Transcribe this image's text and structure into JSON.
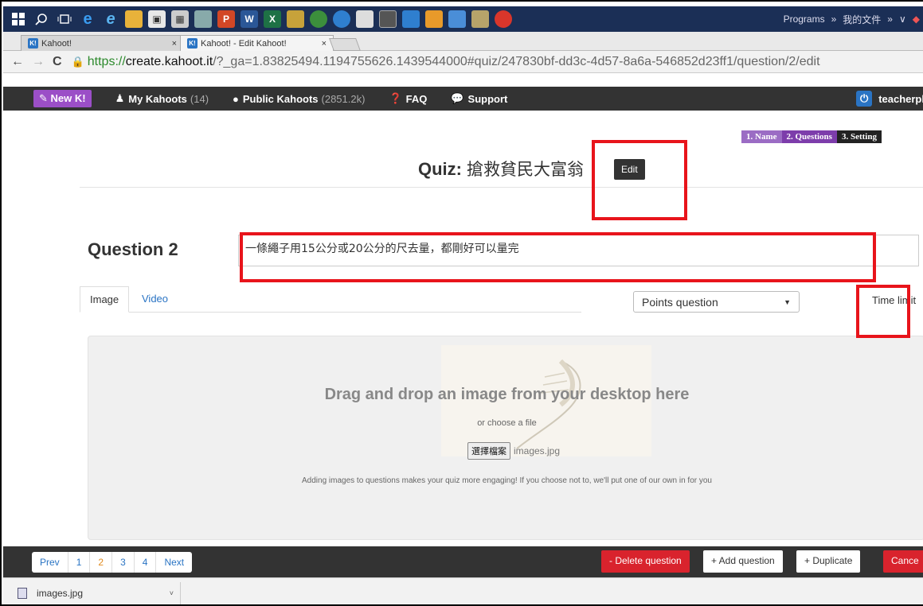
{
  "taskbar": {
    "programs_label": "Programs",
    "docs_label": "我的文件",
    "more_glyph": "»"
  },
  "browser": {
    "tab1_title": "Kahoot!",
    "tab2_title": "Kahoot! - Edit Kahoot!",
    "url_scheme": "https://",
    "url_host": "create.kahoot.it",
    "url_path": "/?_ga=1.83825494.1194755626.1439544000#quiz/247830bf-dd3c-4d57-8a6a-546852d23ff1/question/2/edit"
  },
  "nav": {
    "new_k": "New K!",
    "my_kahoots": "My Kahoots",
    "my_kahoots_count": "(14)",
    "public_kahoots": "Public Kahoots",
    "public_count": "(2851.2k)",
    "faq": "FAQ",
    "support": "Support",
    "user": "teacherpl"
  },
  "steps": [
    "1. Name",
    "2. Questions",
    "3. Setting"
  ],
  "quiz": {
    "label": "Quiz:",
    "name": "搶救貧民大富翁",
    "edit_label": "Edit"
  },
  "question": {
    "label": "Question 2",
    "text": "一條繩子用15公分或20公分的尺去量，都剛好可以量完"
  },
  "media_tabs": [
    "Image",
    "Video"
  ],
  "points_select": "Points question",
  "time_limit_label": "Time limit",
  "dropzone": {
    "main": "Drag and drop an image from your desktop here",
    "or": "or choose a file",
    "choose_btn": "選擇檔案",
    "file_name": "images.jpg",
    "hint": "Adding images to questions makes your quiz more engaging! If you choose not to, we'll put one of our own in for you"
  },
  "pager": [
    "Prev",
    "1",
    "2",
    "3",
    "4",
    "Next"
  ],
  "footer_buttons": {
    "delete": "- Delete question",
    "add": "+ Add question",
    "duplicate": "+ Duplicate",
    "cancel": "Cance"
  },
  "download": {
    "file": "images.jpg"
  },
  "colors": {
    "taskbar": "#1b2f56",
    "kahoot_purple": "#9b4fc7",
    "annotation_red": "#e8141b",
    "link_blue": "#2a74c4",
    "danger": "#d9232d"
  }
}
